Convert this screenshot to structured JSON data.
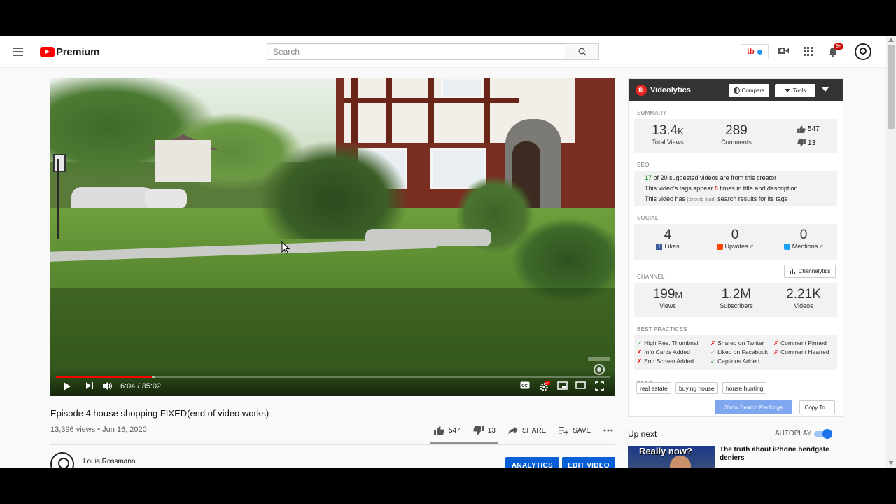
{
  "header": {
    "logo_text": "Premium",
    "search_placeholder": "Search",
    "notification_count": "9+",
    "extension_badge": "tb"
  },
  "player": {
    "time_current": "6:04",
    "time_total": "35:02",
    "time_display": "6:04 / 35:02",
    "progress_fraction": 0.173,
    "buffered_fraction": 0.18
  },
  "video": {
    "title": "Episode 4 house shopping FIXED(end of video works)",
    "meta": "13,396 views • Jun 16, 2020",
    "likes": "547",
    "dislikes": "13",
    "share_label": "SHARE",
    "save_label": "SAVE"
  },
  "channel": {
    "name": "Louis Rossmann",
    "analytics_label": "ANALYTICS",
    "edit_label": "EDIT VIDEO"
  },
  "videolytics": {
    "title": "Videolytics",
    "compare_label": "Compare",
    "tools_label": "Tools",
    "summary_heading": "SUMMARY",
    "total_views_value": "13.4",
    "total_views_suffix": "K",
    "total_views_label": "Total Views",
    "comments_value": "289",
    "comments_label": "Comments",
    "likes_value": "547",
    "dislikes_value": "13",
    "seo_heading": "SEO",
    "seo_count": "17",
    "seo_line1_rest": " of 20 suggested videos are from this creator",
    "seo_line2_pre": "This video's tags appear ",
    "seo_line2_count": "0",
    "seo_line2_post": " times in title and description",
    "seo_line3_pre": "This video has ",
    "seo_line3_tiny": "(click to load)",
    "seo_line3_post": " search results for its tags",
    "social_heading": "SOCIAL",
    "fb_value": "4",
    "fb_label": "Likes",
    "reddit_value": "0",
    "reddit_label": "Upvotes",
    "twitter_value": "0",
    "twitter_label": "Mentions",
    "channel_heading": "CHANNEL",
    "channelytics_label": "Channelytics",
    "ch_views_value": "199",
    "ch_views_suffix": "M",
    "ch_views_label": "Views",
    "ch_subs_value": "1.2M",
    "ch_subs_label": "Subscribers",
    "ch_videos_value": "2.21K",
    "ch_videos_label": "Videos",
    "bp_heading": "BEST PRACTICES",
    "best_practices": [
      {
        "mark": "✓",
        "text": "High Res. Thumbnail"
      },
      {
        "mark": "✗",
        "text": "Shared on Twitter"
      },
      {
        "mark": "✗",
        "text": "Comment Pinned"
      },
      {
        "mark": "✗",
        "text": "Info Cards Added"
      },
      {
        "mark": "✓",
        "text": "Liked on Facebook"
      },
      {
        "mark": "✗",
        "text": "Comment Hearted"
      },
      {
        "mark": "✗",
        "text": "End Screen Added"
      },
      {
        "mark": "✓",
        "text": "Captions Added"
      }
    ],
    "tags_heading": "TAGS",
    "tags": [
      "real estate",
      "buying house",
      "house hunting"
    ],
    "show_rankings_label": "Show Search Rankings",
    "copy_label": "Copy To..."
  },
  "upnext": {
    "heading": "Up next",
    "autoplay_label": "AUTOPLAY",
    "thumb_text": "Really now?",
    "next_title": "The truth about iPhone bendgate deniers"
  },
  "colors": {
    "youtube_red": "#ff0000",
    "blue_button": "#065fd4",
    "videolytics_header": "#333333"
  }
}
